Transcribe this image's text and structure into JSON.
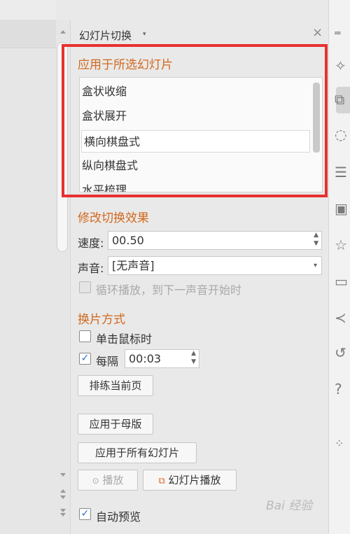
{
  "panel": {
    "title": "幻灯片切换",
    "caret": "▾",
    "close": "×"
  },
  "apply_section": {
    "heading": "应用于所选幻灯片",
    "items": [
      "盒状收缩",
      "盒状展开",
      "横向棋盘式",
      "纵向棋盘式",
      "水平梳理"
    ],
    "selected_index": 2
  },
  "modify_section": {
    "heading": "修改切换效果",
    "speed_label": "速度:",
    "speed_value": "00.50",
    "sound_label": "声音:",
    "sound_value": "[无声音]",
    "loop_label": "循环播放，到下一声音开始时"
  },
  "advance_section": {
    "heading": "换片方式",
    "on_click_label": "单击鼠标时",
    "on_click_checked": false,
    "every_label": "每隔",
    "every_checked": true,
    "every_value": "00:03",
    "rehearse_button": "排练当前页"
  },
  "buttons": {
    "apply_master": "应用于母版",
    "apply_all": "应用于所有幻灯片",
    "play": "播放",
    "slideshow": "幻灯片播放"
  },
  "auto_preview": {
    "label": "自动预览",
    "checked": true
  },
  "watermark": "Bai 经验",
  "icons": [
    "magic-icon",
    "transition-icon",
    "shape-icon",
    "settings-icon",
    "picture-icon",
    "star-icon",
    "backup-icon",
    "share-icon",
    "history-icon",
    "help-icon",
    "more-icon"
  ],
  "colors": {
    "section": "#d2691e",
    "highlight": "#e8312f",
    "check": "#2d6fd1"
  }
}
